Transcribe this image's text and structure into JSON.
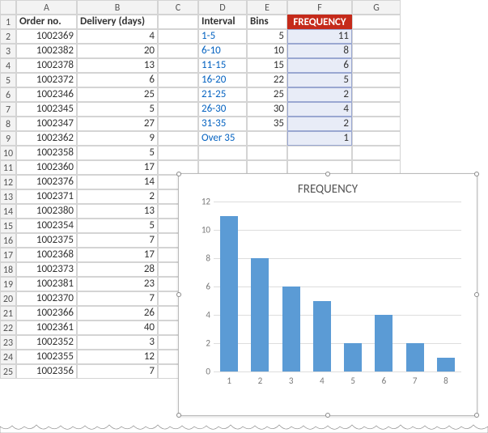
{
  "columns": [
    "A",
    "B",
    "C",
    "D",
    "E",
    "F",
    "G"
  ],
  "row_numbers": [
    1,
    2,
    3,
    4,
    5,
    6,
    7,
    8,
    9,
    10,
    11,
    12,
    13,
    14,
    15,
    16,
    17,
    18,
    19,
    20,
    21,
    22,
    23,
    24,
    25
  ],
  "head_a": "Order no.",
  "head_b": "Delivery (days)",
  "orders": [
    {
      "no": "1002369",
      "d": "4"
    },
    {
      "no": "1002382",
      "d": "20"
    },
    {
      "no": "1002378",
      "d": "13"
    },
    {
      "no": "1002372",
      "d": "6"
    },
    {
      "no": "1002346",
      "d": "25"
    },
    {
      "no": "1002345",
      "d": "5"
    },
    {
      "no": "1002347",
      "d": "27"
    },
    {
      "no": "1002362",
      "d": "9"
    },
    {
      "no": "1002358",
      "d": "5"
    },
    {
      "no": "1002360",
      "d": "17"
    },
    {
      "no": "1002376",
      "d": "14"
    },
    {
      "no": "1002371",
      "d": "2"
    },
    {
      "no": "1002380",
      "d": "13"
    },
    {
      "no": "1002354",
      "d": "5"
    },
    {
      "no": "1002375",
      "d": "7"
    },
    {
      "no": "1002368",
      "d": "17"
    },
    {
      "no": "1002373",
      "d": "28"
    },
    {
      "no": "1002381",
      "d": "23"
    },
    {
      "no": "1002370",
      "d": "7"
    },
    {
      "no": "1002366",
      "d": "26"
    },
    {
      "no": "1002361",
      "d": "40"
    },
    {
      "no": "1002352",
      "d": "3"
    },
    {
      "no": "1002355",
      "d": "12"
    },
    {
      "no": "1002356",
      "d": "7"
    }
  ],
  "head_d": "Interval",
  "head_e": "Bins",
  "head_f": "FREQUENCY",
  "freq_table": [
    {
      "int": "1-5",
      "bin": "5",
      "f": "11"
    },
    {
      "int": "6-10",
      "bin": "10",
      "f": "8"
    },
    {
      "int": "11-15",
      "bin": "15",
      "f": "6"
    },
    {
      "int": "16-20",
      "bin": "22",
      "f": "5"
    },
    {
      "int": "21-25",
      "bin": "25",
      "f": "2"
    },
    {
      "int": "26-30",
      "bin": "30",
      "f": "4"
    },
    {
      "int": "31-35",
      "bin": "35",
      "f": "2"
    },
    {
      "int": "Over 35",
      "bin": "",
      "f": "1"
    }
  ],
  "chart_data": {
    "type": "bar",
    "title": "FREQUENCY",
    "categories": [
      "1",
      "2",
      "3",
      "4",
      "5",
      "6",
      "7",
      "8"
    ],
    "values": [
      11,
      8,
      6,
      5,
      2,
      4,
      2,
      1
    ],
    "ylim": [
      0,
      12
    ],
    "yticks": [
      0,
      2,
      4,
      6,
      8,
      10,
      12
    ]
  }
}
